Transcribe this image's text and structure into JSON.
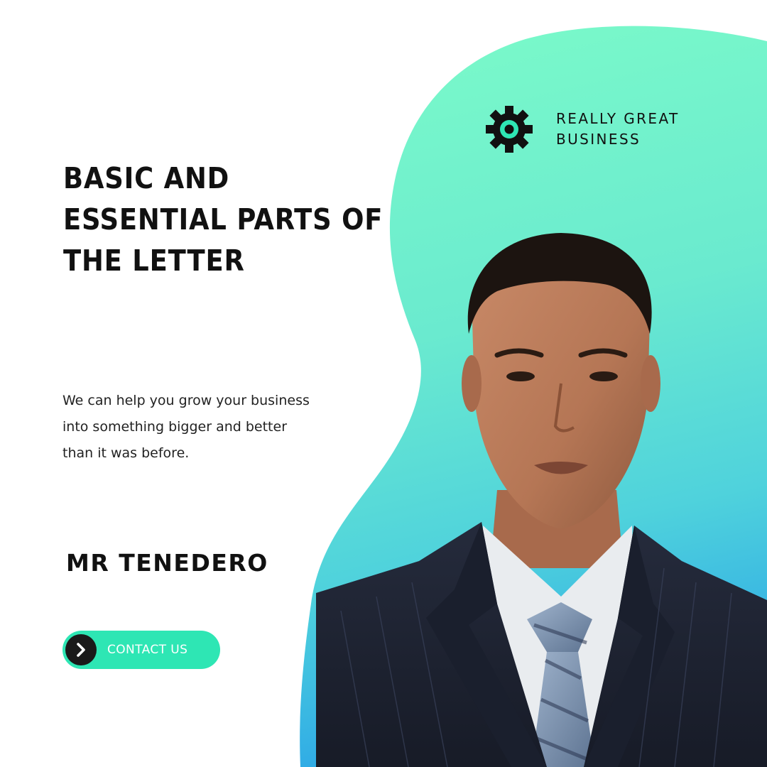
{
  "brand": {
    "name_line1": "REALLY GREAT",
    "name_line2": "BUSINESS",
    "icon": "gear-icon"
  },
  "headline": {
    "line1": "BASIC AND",
    "line2": "ESSENTIAL PARTS OF",
    "line3": "THE LETTER"
  },
  "body": {
    "line1": "We can help you grow your business",
    "line2": "into something bigger and better",
    "line3": "than it was before."
  },
  "person": {
    "name": "MR TENEDERO"
  },
  "contact": {
    "label": "CONTACT US",
    "icon": "chevron-right-icon"
  },
  "colors": {
    "accent": "#2ee6b4",
    "blob_top": "#7af8c8",
    "blob_bottom": "#31aee6",
    "suit": "#1d2333",
    "text": "#111111"
  }
}
